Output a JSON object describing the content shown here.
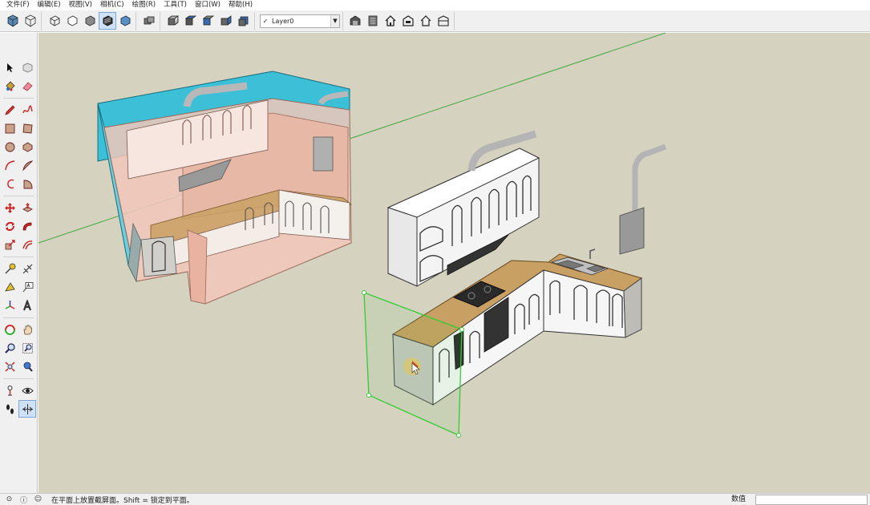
{
  "menu": [
    {
      "id": "file",
      "label": "文件(F)"
    },
    {
      "id": "edit",
      "label": "编辑(E)"
    },
    {
      "id": "view",
      "label": "视图(V)"
    },
    {
      "id": "camera",
      "label": "相机(C)"
    },
    {
      "id": "draw",
      "label": "绘图(R)"
    },
    {
      "id": "tools",
      "label": "工具(T)"
    },
    {
      "id": "window",
      "label": "窗口(W)"
    },
    {
      "id": "help",
      "label": "帮助(H)"
    }
  ],
  "toolbar": {
    "layer_check": "✓",
    "layer_name": "Layer0",
    "layer_arrow": "▼"
  },
  "status": {
    "message": "在平面上放置截屏面。Shift = 锁定到平面。",
    "measurements_label": "数值",
    "measurements_value": ""
  },
  "colors": {
    "viewport_bg": "#d5d2c0",
    "section_plane": "#33cc33",
    "glass_cyan": "#3cc0d8",
    "section_fill": "#f2c7b8",
    "countertop": "#c9a063",
    "cabinet_white": "#f4f4f4",
    "axis_green": "#44aa44"
  }
}
